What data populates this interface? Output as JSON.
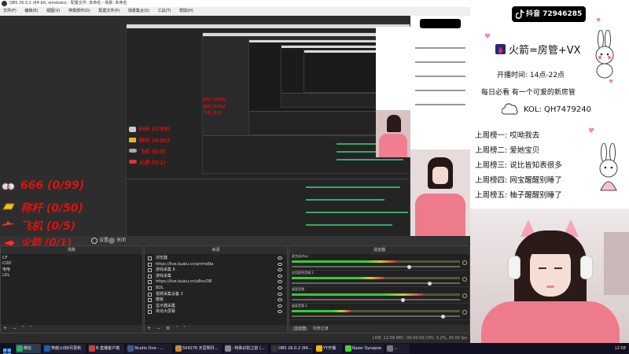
{
  "window": {
    "title": "OBS 26.0.2 (64-bit, windows) - 配置文件: 未命名 - 场景: 未命名"
  },
  "menu": {
    "items": [
      "文件(F)",
      "编辑(E)",
      "视图(V)",
      "停靠部件(D)",
      "配置文件(P)",
      "场景集合(S)",
      "工具(T)",
      "帮助(H)"
    ]
  },
  "gifts": [
    {
      "text": "666 (0/99)",
      "icon": "six-icon"
    },
    {
      "text": "称杆 (0/50)",
      "icon": "gold-bar-icon"
    },
    {
      "text": "飞机 (0/5)",
      "icon": "plane-icon"
    },
    {
      "text": "火箭 (0/1)",
      "icon": "rocket-icon"
    }
  ],
  "dock_header": {
    "gear_icon": "gear-icon",
    "label": "设置",
    "close_icon": "close-icon",
    "close_label": "关闭"
  },
  "docks": {
    "scenes": {
      "title": "场景",
      "items": [
        "CF",
        "COD",
        "电电",
        "LOL"
      ]
    },
    "sources": {
      "title": "来源",
      "items": [
        {
          "label": "浏览器",
          "icon": "browser-icon"
        },
        {
          "label": "https://live.kuaiu.cn/ammd9a",
          "icon": "browser-icon"
        },
        {
          "label": "游戏采集 6",
          "icon": "gamepad-icon"
        },
        {
          "label": "游戏采集",
          "icon": "gamepad-icon"
        },
        {
          "label": "https://live.kuaiu.cn/a8vul3B",
          "icon": "browser-icon"
        },
        {
          "label": "BDL",
          "icon": "text-icon"
        },
        {
          "label": "视频采集设备 2",
          "icon": "camera-icon"
        },
        {
          "label": "模板",
          "icon": "image-icon"
        },
        {
          "label": "显示器采集",
          "icon": "monitor-icon"
        },
        {
          "label": "单动大屏幕",
          "icon": "monitor-icon"
        }
      ]
    },
    "mixer": {
      "title": "混音器",
      "tracks": [
        {
          "name": "麦克风/Aux",
          "level": 0.62,
          "volume": 0.7
        },
        {
          "name": "应用程序音频 2",
          "level": 0.55,
          "volume": 0.82
        },
        {
          "name": "桌面音频",
          "level": 0.78,
          "volume": 0.66
        },
        {
          "name": "桌面音频 2",
          "level": 0.35,
          "volume": 0.9
        }
      ],
      "tabs": [
        "混音器",
        "场景过渡"
      ]
    }
  },
  "status": {
    "text": "LIVE: 12:58   REC: 00:00:00   CPU: 3.2%, 30.00 fps"
  },
  "taskbar": {
    "items": [
      {
        "label": "微信",
        "color": "#2aae67"
      },
      {
        "label": "穿越火线8月更新",
        "color": "#1b5fae"
      },
      {
        "label": "B 直播客户端",
        "color": "#d23c3c"
      },
      {
        "label": "Studio One - ...",
        "color": "#3b5b8c"
      },
      {
        "label": "504276 天涯明月...",
        "color": "#c84"
      },
      {
        "label": "- 特殊识别之前 (...",
        "color": "#888"
      },
      {
        "label": "OBS 26.0.2 (64...",
        "color": "#333"
      },
      {
        "label": "YY开播",
        "color": "#f5b800"
      },
      {
        "label": "Razer Synapse",
        "color": "#44d62c"
      },
      {
        "label": "...",
        "color": "#777"
      }
    ],
    "clock": "12:58"
  },
  "stream_panel": {
    "douyin_id": "抖音 72946285",
    "wechat_line": "火箭=房管+VX",
    "hours": "开播时间: 14点-22点",
    "daily": "每日必看 有一个可爱的新房管",
    "kol": "KOL: QH7479240",
    "ranks": [
      "上周榜一: 哎呦我去",
      "上周榜二: 爱她宝贝",
      "上周榜三: 说比皆知表很多",
      "上周榜四: 网宝醒醒别睡了",
      "上周榜五: 柚子醒醒别睡了"
    ],
    "accent": "#f08aa8"
  }
}
